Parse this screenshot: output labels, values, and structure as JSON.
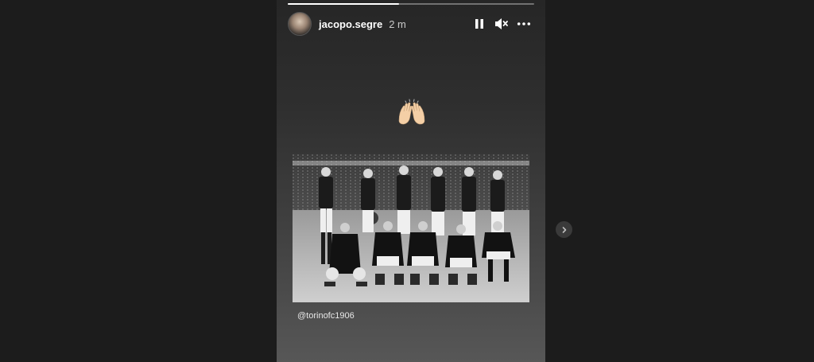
{
  "story": {
    "progress_fraction": 0.45,
    "user": {
      "username": "jacopo.segre",
      "time_ago": "2 m"
    },
    "controls": {
      "pause_icon": "pause-icon",
      "mute_icon": "speaker-muted-icon",
      "more_icon": "more-options-icon"
    },
    "emoji": "🙌",
    "mention": "@torinofc1906"
  },
  "navigation": {
    "next_icon": "chevron-right-icon"
  },
  "colors": {
    "page_background": "#1c1c1c",
    "story_top": "#262626",
    "story_bottom": "#575757",
    "text": "#ffffff"
  }
}
